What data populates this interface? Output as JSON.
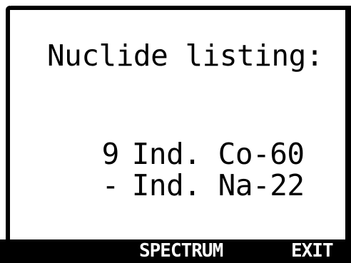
{
  "screen": {
    "title": "Nuclide listing:"
  },
  "nuclides": [
    {
      "marker": "9",
      "name": "Ind. Co-60"
    },
    {
      "marker": "-",
      "name": "Ind. Na-22"
    }
  ],
  "softkeys": {
    "left": "",
    "middle": "SPECTRUM",
    "right": "EXIT"
  }
}
